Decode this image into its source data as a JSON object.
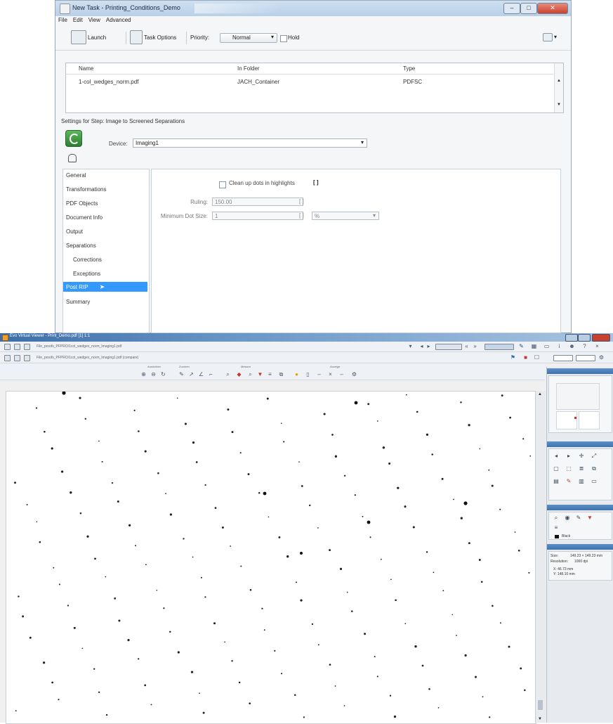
{
  "task_window": {
    "title": "New Task - Printing_Conditions_Demo",
    "menu": [
      "File",
      "Edit",
      "View",
      "Advanced"
    ],
    "toolbar": {
      "launch_label": "Launch",
      "task_options_label": "Task Options",
      "priority_label": "Priority:",
      "priority_value": "Normal",
      "hold_label": "Hold"
    },
    "file_table": {
      "columns": [
        "Name",
        "In Folder",
        "Type"
      ],
      "rows": [
        {
          "name": "1-col_wedges_norm.pdf",
          "folder": "JACH_Container",
          "type": "PDFSC"
        }
      ]
    },
    "settings_label": "Settings for Step: Image to Screened Separations",
    "device_label": "Device:",
    "device_value": "Imaging1",
    "nav_items": [
      "General",
      "Transformations",
      "PDF Objects",
      "Document Info",
      "Output",
      "Separations",
      "Corrections",
      "Exceptions",
      "Post RIP",
      "Summary"
    ],
    "nav_selected": "Post RIP",
    "panel": {
      "cleanup_label": "Clean up dots in highlights",
      "ruling_label": "Ruling:",
      "ruling_value": "150.00",
      "min_dot_label": "Minimum Dot Size:",
      "min_dot_value": "1",
      "unit_value": "%"
    }
  },
  "viewer_window": {
    "title": "Evo Virtual Viewer - Print_Demo.pdf [1] 1:1",
    "path1": "File_proofs_PFPRO/1col_wedges_norm_Imaging1.pdf",
    "path2": "File_proofs_PFPRO/1col_wedges_norm_Imaging1.pdf (compare)",
    "toolbar_groups": [
      "Ausrichten",
      "Zoomen",
      "Messen",
      "Anzeige"
    ],
    "dock": {
      "size_label": "Size:",
      "size_value": "149.23 × 149.23 mm",
      "resolution_label": "Resolution:",
      "resolution_value": "1000 dpi",
      "coord_x": "X: 46.73 mm",
      "coord_y": "Y: 148.10 mm",
      "color_name": "Black"
    }
  }
}
